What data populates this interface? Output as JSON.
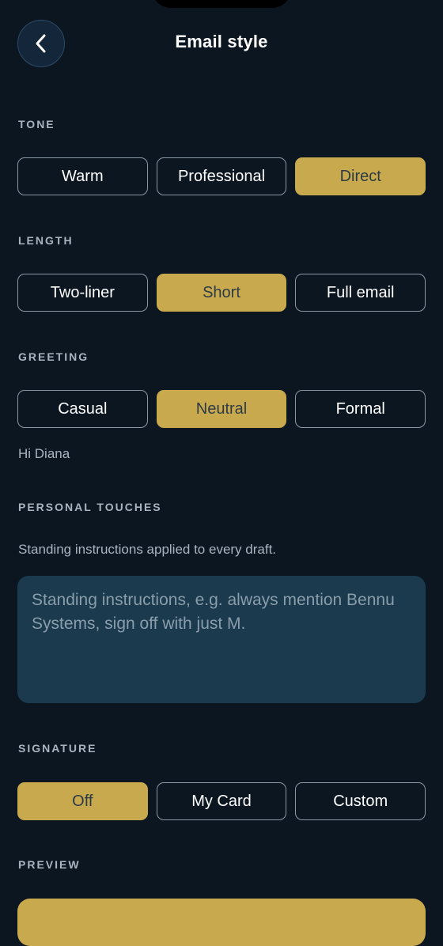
{
  "header": {
    "title": "Email style",
    "back_icon": "chevron-left-icon"
  },
  "tone": {
    "label": "TONE",
    "options": [
      "Warm",
      "Professional",
      "Direct"
    ],
    "selected": "Direct"
  },
  "length": {
    "label": "LENGTH",
    "options": [
      "Two-liner",
      "Short",
      "Full email"
    ],
    "selected": "Short"
  },
  "greeting": {
    "label": "GREETING",
    "options": [
      "Casual",
      "Neutral",
      "Formal"
    ],
    "selected": "Neutral",
    "example": "Hi Diana"
  },
  "personal_touches": {
    "label": "PERSONAL TOUCHES",
    "helper": "Standing instructions applied to every draft.",
    "value": "",
    "placeholder": "Standing instructions, e.g. always mention Bennu Systems, sign off with just M."
  },
  "signature": {
    "label": "SIGNATURE",
    "options": [
      "Off",
      "My Card",
      "Custom"
    ],
    "selected": "Off"
  },
  "preview": {
    "label": "PREVIEW"
  },
  "colors": {
    "background": "#0c1621",
    "accent": "#c9a94e",
    "selected_text": "#2d3b46",
    "label_text": "#a9b4c0",
    "input_bg": "#1b3a4e"
  }
}
